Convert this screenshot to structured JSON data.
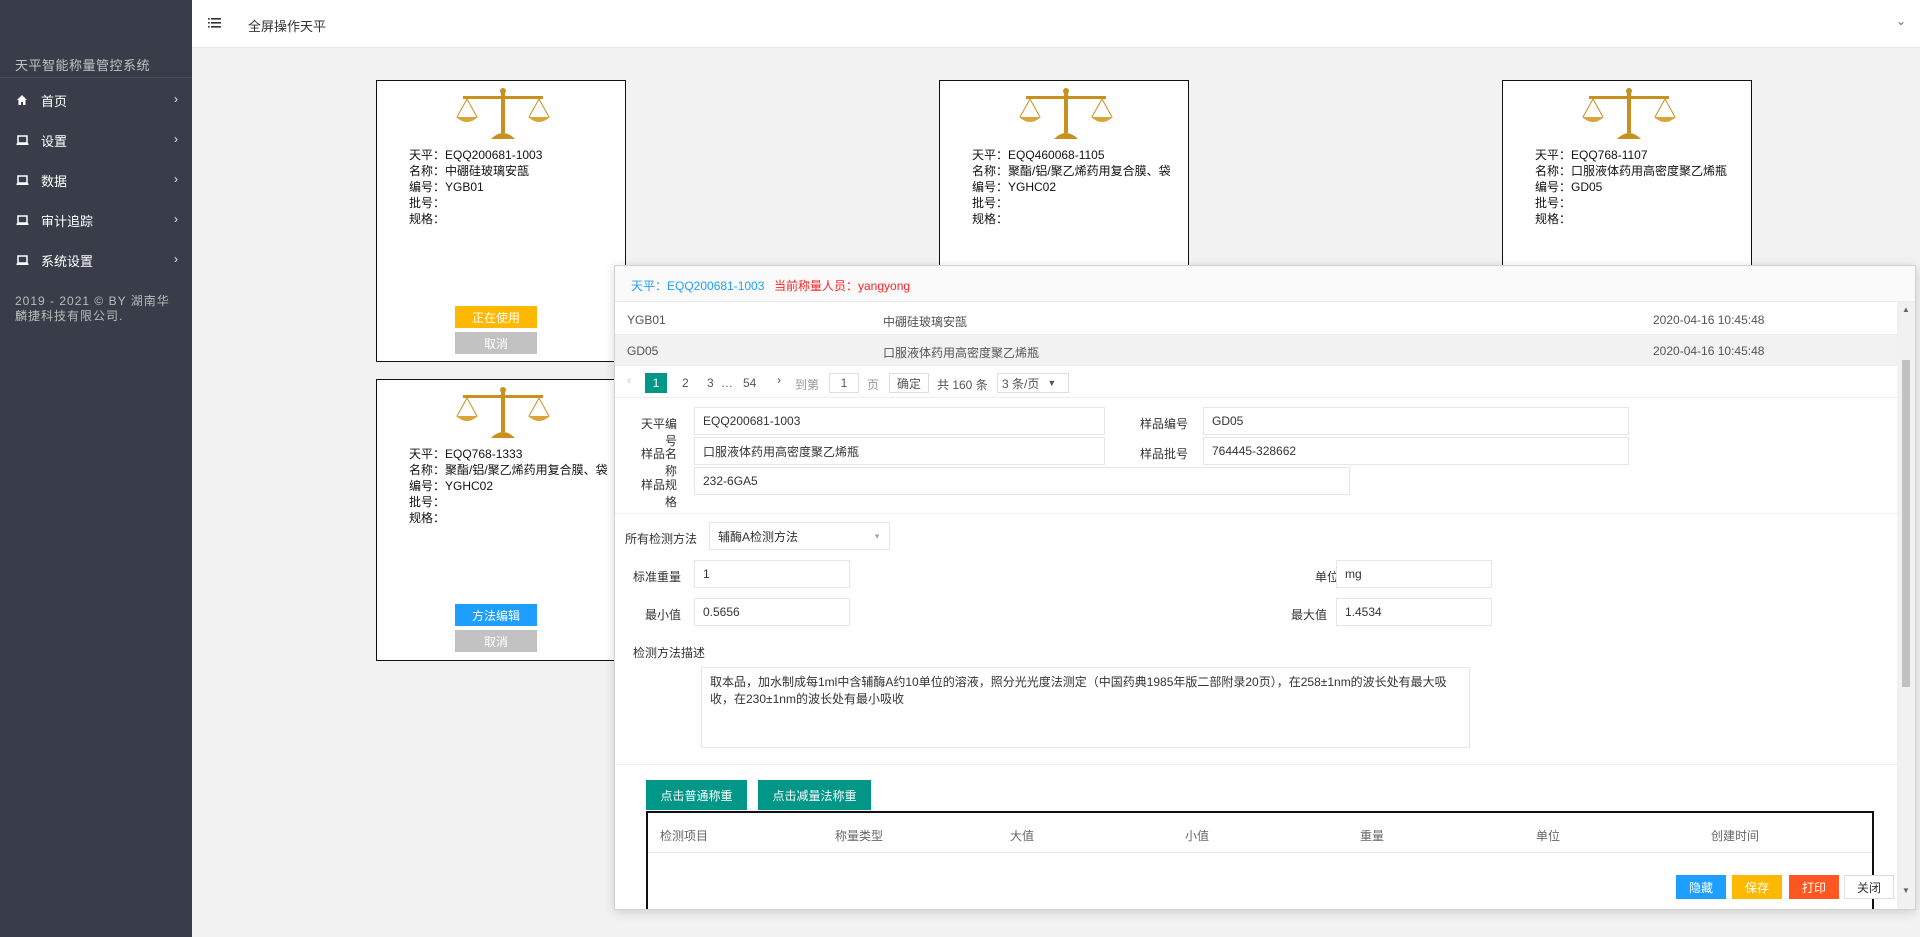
{
  "sidebar": {
    "title": "天平智能称量管控系统",
    "items": [
      {
        "label": "首页",
        "icon": "home-icon"
      },
      {
        "label": "设置",
        "icon": "laptop-icon"
      },
      {
        "label": "数据",
        "icon": "laptop-icon"
      },
      {
        "label": "审计追踪",
        "icon": "laptop-icon"
      },
      {
        "label": "系统设置",
        "icon": "laptop-icon"
      }
    ],
    "copyright": "2019 - 2021 © BY 湖南华麟捷科技有限公司."
  },
  "header": {
    "title": "全屏操作天平"
  },
  "cards": [
    {
      "balance": "天平：EQQ200681-1003",
      "name": "名称：中硼硅玻璃安瓿",
      "code": "编号：YGB01",
      "batch": "批号：",
      "spec": "规格：",
      "btn1": "正在使用",
      "btn2": "取消"
    },
    {
      "balance": "天平：EQQ460068-1105",
      "name": "名称：聚酯/铝/聚乙烯药用复合膜、袋",
      "code": "编号：YGHC02",
      "batch": "批号：",
      "spec": "规格："
    },
    {
      "balance": "天平：EQQ768-1107",
      "name": "名称：口服液体药用高密度聚乙烯瓶",
      "code": "编号：GD05",
      "batch": "批号：",
      "spec": "规格："
    },
    {
      "balance": "天平：EQQ768-1333",
      "name": "名称：聚酯/铝/聚乙烯药用复合膜、袋",
      "code": "编号：YGHC02",
      "batch": "批号：",
      "spec": "规格：",
      "btn1": "方法编辑",
      "btn2": "取消"
    }
  ],
  "dialog": {
    "balance_label": "天平：EQQ200681-1003",
    "operator_label": "当前称量人员：yangyong",
    "rows": [
      {
        "code": "YGB01",
        "name": "中硼硅玻璃安瓿",
        "time": "2020-04-16 10:45:48"
      },
      {
        "code": "GD05",
        "name": "口服液体药用高密度聚乙烯瓶",
        "time": "2020-04-16 10:45:48"
      }
    ],
    "pager": {
      "prev": "‹",
      "p1": "1",
      "p2": "2",
      "p3": "3",
      "ellipsis": "…",
      "p54": "54",
      "next": "›",
      "goto": "到第",
      "page_input": "1",
      "page_unit": "页",
      "confirm": "确定",
      "total": "共 160 条",
      "per_page": "3 条/页"
    },
    "form": {
      "balance_no_label": "天平编号",
      "balance_no": "EQQ200681-1003",
      "sample_no_label": "样品编号",
      "sample_no": "GD05",
      "sample_name_label": "样品名称",
      "sample_name": "口服液体药用高密度聚乙烯瓶",
      "sample_batch_label": "样品批号",
      "sample_batch": "764445-328662",
      "sample_spec_label": "样品规格",
      "sample_spec": "232-6GA5"
    },
    "method": {
      "all_label": "所有检测方法",
      "selected": "辅酶A检测方法",
      "std_weight_label": "标准重量",
      "std_weight": "1",
      "unit_label": "单位",
      "unit": "mg",
      "min_label": "最小值",
      "min": "0.5656",
      "max_label": "最大值",
      "max": "1.4534",
      "desc_label": "检测方法描述",
      "desc": "取本品，加水制成每1ml中含辅酶A约10单位的溶液，照分光光度法测定（中国药典1985年版二部附录20页），在258±1nm的波长处有最大吸收，在230±1nm的波长处有最小吸收"
    },
    "tabs": {
      "normal": "点击普通称重",
      "subtract": "点击减量法称重"
    },
    "table_headers": [
      "检测项目",
      "称量类型",
      "大值",
      "小值",
      "重量",
      "单位",
      "创建时间"
    ],
    "footer": {
      "hide": "隐藏",
      "save": "保存",
      "print": "打印",
      "close": "关闭"
    }
  },
  "colors": {
    "sidebar_bg": "#393d49",
    "green": "#009688",
    "blue": "#1e9fff",
    "orange": "#ffb800",
    "red": "#ff5722"
  }
}
